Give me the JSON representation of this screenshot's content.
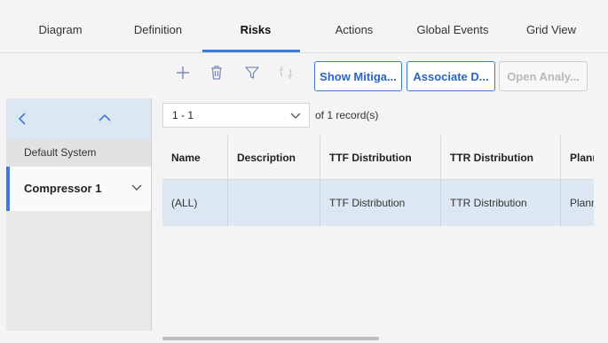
{
  "tabs": [
    {
      "label": "Diagram"
    },
    {
      "label": "Definition"
    },
    {
      "label": "Risks"
    },
    {
      "label": "Actions"
    },
    {
      "label": "Global Events"
    },
    {
      "label": "Grid View"
    }
  ],
  "active_tab": "Risks",
  "toolbar": {
    "icons": [
      "add-icon",
      "delete-icon",
      "filter-icon",
      "refresh-icon"
    ],
    "show_mitigation_label": "Show Mitiga...",
    "associate_label": "Associate D...",
    "open_analysis_label": "Open Analy..."
  },
  "sidebar": {
    "item1": "Default System",
    "item2": "Compressor 1"
  },
  "pager": {
    "value": "1 - 1",
    "of_text": "of 1 record(s)"
  },
  "grid": {
    "columns": [
      "Name",
      "Description",
      "TTF Distribution",
      "TTR Distribution",
      "Planned"
    ],
    "rows": [
      [
        "(ALL)",
        "",
        "TTF Distribution",
        "TTR Distribution",
        "Planned"
      ]
    ]
  },
  "colors": {
    "accent": "#3e7bd6",
    "selected_row": "#dce7f4"
  }
}
